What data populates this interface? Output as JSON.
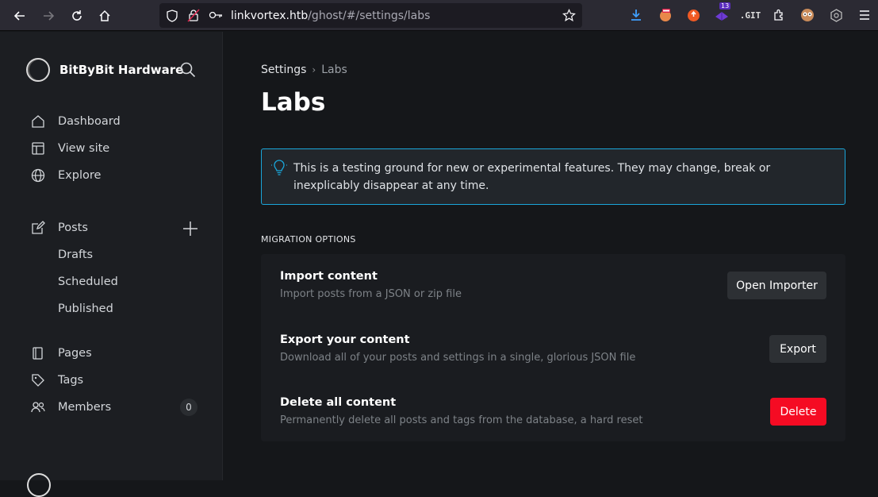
{
  "browser": {
    "url_host": "linkvortex.htb",
    "url_path": "/ghost/#/settings/labs",
    "extension_badge_count": "13"
  },
  "sidebar": {
    "site_name": "BitByBit Hardware",
    "items": [
      {
        "label": "Dashboard"
      },
      {
        "label": "View site"
      },
      {
        "label": "Explore"
      },
      {
        "label": "Posts"
      },
      {
        "label": "Drafts"
      },
      {
        "label": "Scheduled"
      },
      {
        "label": "Published"
      },
      {
        "label": "Pages"
      },
      {
        "label": "Tags"
      },
      {
        "label": "Members"
      }
    ],
    "members_count": "0"
  },
  "main": {
    "breadcrumb": {
      "root": "Settings",
      "current": "Labs"
    },
    "title": "Labs",
    "notice": "This is a testing ground for new or experimental features. They may change, break or inexplicably disappear at any time.",
    "section_label": "MIGRATION OPTIONS",
    "rows": [
      {
        "title": "Import content",
        "desc": "Import posts from a JSON or zip file",
        "button": "Open Importer"
      },
      {
        "title": "Export your content",
        "desc": "Download all of your posts and settings in a single, glorious JSON file",
        "button": "Export"
      },
      {
        "title": "Delete all content",
        "desc": "Permanently delete all posts and tags from the database, a hard reset",
        "button": "Delete"
      }
    ]
  },
  "colors": {
    "accent_blue": "#1aa6da",
    "danger_red": "#f50b23"
  }
}
